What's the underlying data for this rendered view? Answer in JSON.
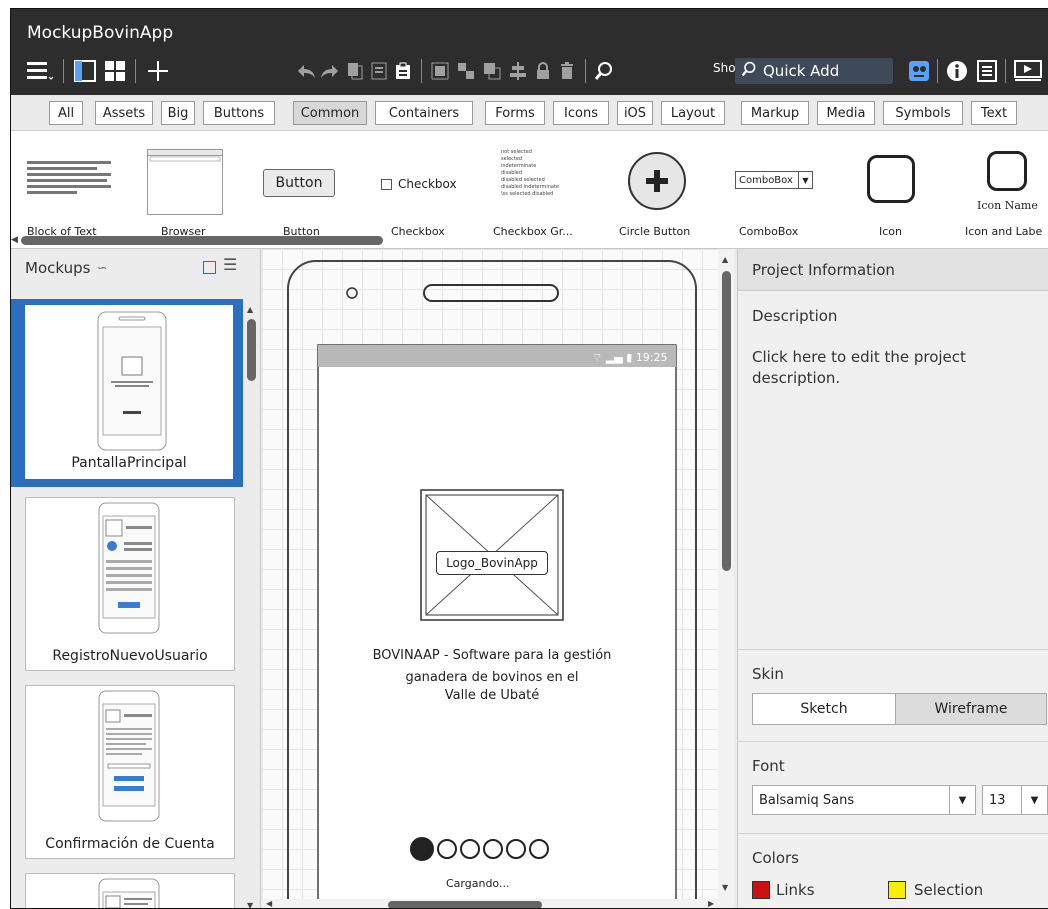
{
  "app": {
    "title": "MockupBovinApp"
  },
  "toolbar": {
    "show_label": "Show",
    "quick_add": "Quick Add"
  },
  "filters": [
    "All",
    "Assets",
    "Big",
    "Buttons",
    "Common",
    "Containers",
    "Forms",
    "Icons",
    "iOS",
    "Layout",
    "Markup",
    "Media",
    "Symbols",
    "Text"
  ],
  "filters_active": "Common",
  "library": {
    "items": [
      "Block of Text",
      "Browser",
      "Button",
      "Checkbox",
      "Checkbox Gr...",
      "Circle Button",
      "ComboBox",
      "Icon",
      "Icon and Labe"
    ],
    "button_text": "Button",
    "checkbox_text": "Checkbox",
    "combobox_text": "ComboBox",
    "icon_name_text": "Icon Name",
    "checkbox_group_lines": [
      "not selected",
      "selected",
      "indeterminate",
      "disabled",
      "disabled selected",
      "disabled indeterminate",
      "\\ss selected disabled"
    ]
  },
  "mockups": {
    "title": "Mockups",
    "items": [
      {
        "label": "PantallaPrincipal",
        "selected": true
      },
      {
        "label": "RegistroNuevoUsuario",
        "selected": false
      },
      {
        "label": "Confirmación de Cuenta",
        "selected": false
      }
    ]
  },
  "canvas": {
    "status_time": "19:25",
    "logo_label": "Logo_BovinApp",
    "headline_1": "BOVINAAP - Software para la gestión",
    "headline_2": "ganadera de bovinos en el",
    "headline_3": "Valle de Ubaté",
    "loading": "Cargando...",
    "progress_dots_filled": 1,
    "progress_dots_total": 6
  },
  "properties": {
    "header": "Project Information",
    "description_label": "Description",
    "description_text": "Click here to edit the project description.",
    "skin_label": "Skin",
    "skin_options": [
      "Sketch",
      "Wireframe"
    ],
    "skin_selected": "Wireframe",
    "font_label": "Font",
    "font_family": "Balsamiq Sans",
    "font_size": "13",
    "colors_label": "Colors",
    "links_label": "Links",
    "links_color": "#cc1111",
    "selection_label": "Selection",
    "selection_color": "#f4f000"
  }
}
